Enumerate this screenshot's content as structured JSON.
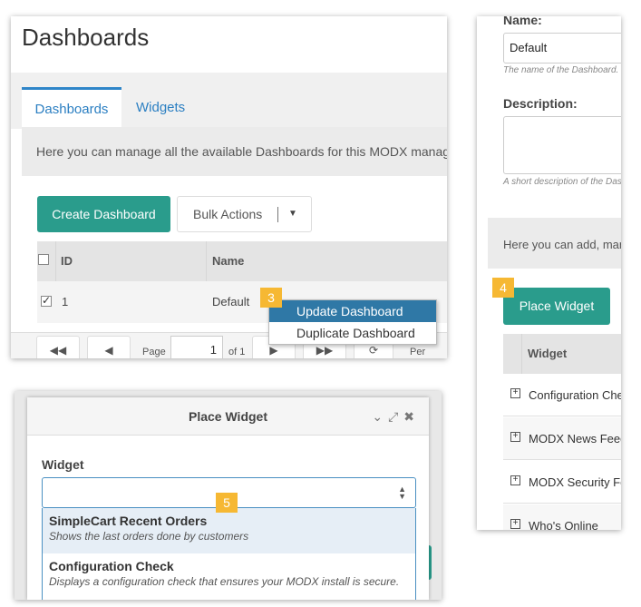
{
  "dashboards_panel": {
    "title": "Dashboards",
    "tabs": [
      {
        "label": "Dashboards",
        "active": true
      },
      {
        "label": "Widgets",
        "active": false
      }
    ],
    "description": "Here you can manage all the available Dashboards for this MODX manager.",
    "create_button": "Create Dashboard",
    "bulk_button": "Bulk Actions",
    "columns": {
      "id": "ID",
      "name": "Name"
    },
    "rows": [
      {
        "id": "1",
        "name": "Default",
        "checked": true
      }
    ],
    "context_menu": [
      "Update Dashboard",
      "Duplicate Dashboard"
    ],
    "pager": {
      "page_label": "Page",
      "page_value": "1",
      "of_label": "of 1",
      "per_page_label": "Per Page"
    },
    "step_badge": "3"
  },
  "edit_panel": {
    "name_label": "Name:",
    "name_value": "Default",
    "name_hint": "The name of the Dashboard.",
    "description_label": "Description:",
    "description_hint": "A short description of the Dashboard.",
    "widgets_intro": "Here you can add, manage and remove Widgets from this Dashboard.",
    "place_button": "Place Widget",
    "step_badge": "4",
    "widgets_column": "Widget",
    "widgets": [
      "Configuration Check",
      "MODX News Feed",
      "MODX Security Feed",
      "Who's Online"
    ]
  },
  "place_widget_dialog": {
    "title": "Place Widget",
    "widget_label": "Widget",
    "step_badge": "5",
    "options": [
      {
        "title": "SimpleCart Recent Orders",
        "desc": "Shows the last orders done by customers",
        "highlighted": true
      },
      {
        "title": "Configuration Check",
        "desc": "Displays a configuration check that ensures your MODX install is secure.",
        "highlighted": false
      }
    ]
  }
}
